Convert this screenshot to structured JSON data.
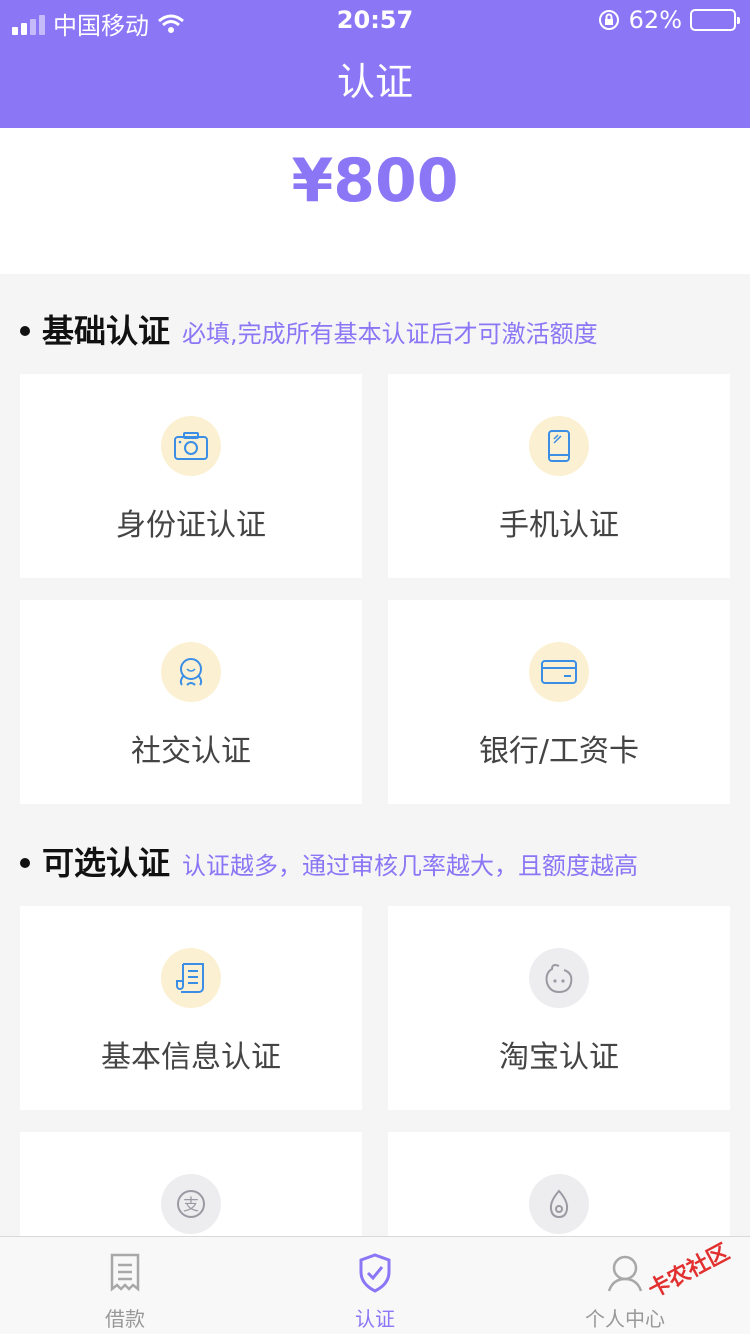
{
  "status_bar": {
    "carrier": "中国移动",
    "time": "20:57",
    "battery_percent": "62%",
    "battery_level": 0.62
  },
  "nav": {
    "title": "认证"
  },
  "credit": {
    "amount": "¥800"
  },
  "sections": [
    {
      "title": "基础认证",
      "hint": "必填,完成所有基本认证后才可激活额度",
      "items": [
        {
          "label": "身份证认证",
          "icon": "camera-icon"
        },
        {
          "label": "手机认证",
          "icon": "phone-icon"
        },
        {
          "label": "社交认证",
          "icon": "social-icon"
        },
        {
          "label": "银行/工资卡",
          "icon": "bank-card-icon"
        }
      ]
    },
    {
      "title": "可选认证",
      "hint": "认证越多，通过审核几率越大，且额度越高",
      "items": [
        {
          "label": "基本信息认证",
          "icon": "document-icon"
        },
        {
          "label": "淘宝认证",
          "icon": "taobao-icon"
        },
        {
          "label": "",
          "icon": "alipay-icon"
        },
        {
          "label": "",
          "icon": "drop-icon"
        }
      ]
    }
  ],
  "tabbar": {
    "items": [
      {
        "label": "借款",
        "icon": "loan-icon"
      },
      {
        "label": "认证",
        "icon": "shield-check-icon",
        "active": true
      },
      {
        "label": "个人中心",
        "icon": "user-icon"
      }
    ]
  },
  "watermark": {
    "text": "卡农社区"
  },
  "colors": {
    "primary": "#8b76f6",
    "icon_blue": "#3a8ee6",
    "icon_bg_yellow": "#fbf1d2",
    "icon_bg_gray": "#ededf0"
  }
}
